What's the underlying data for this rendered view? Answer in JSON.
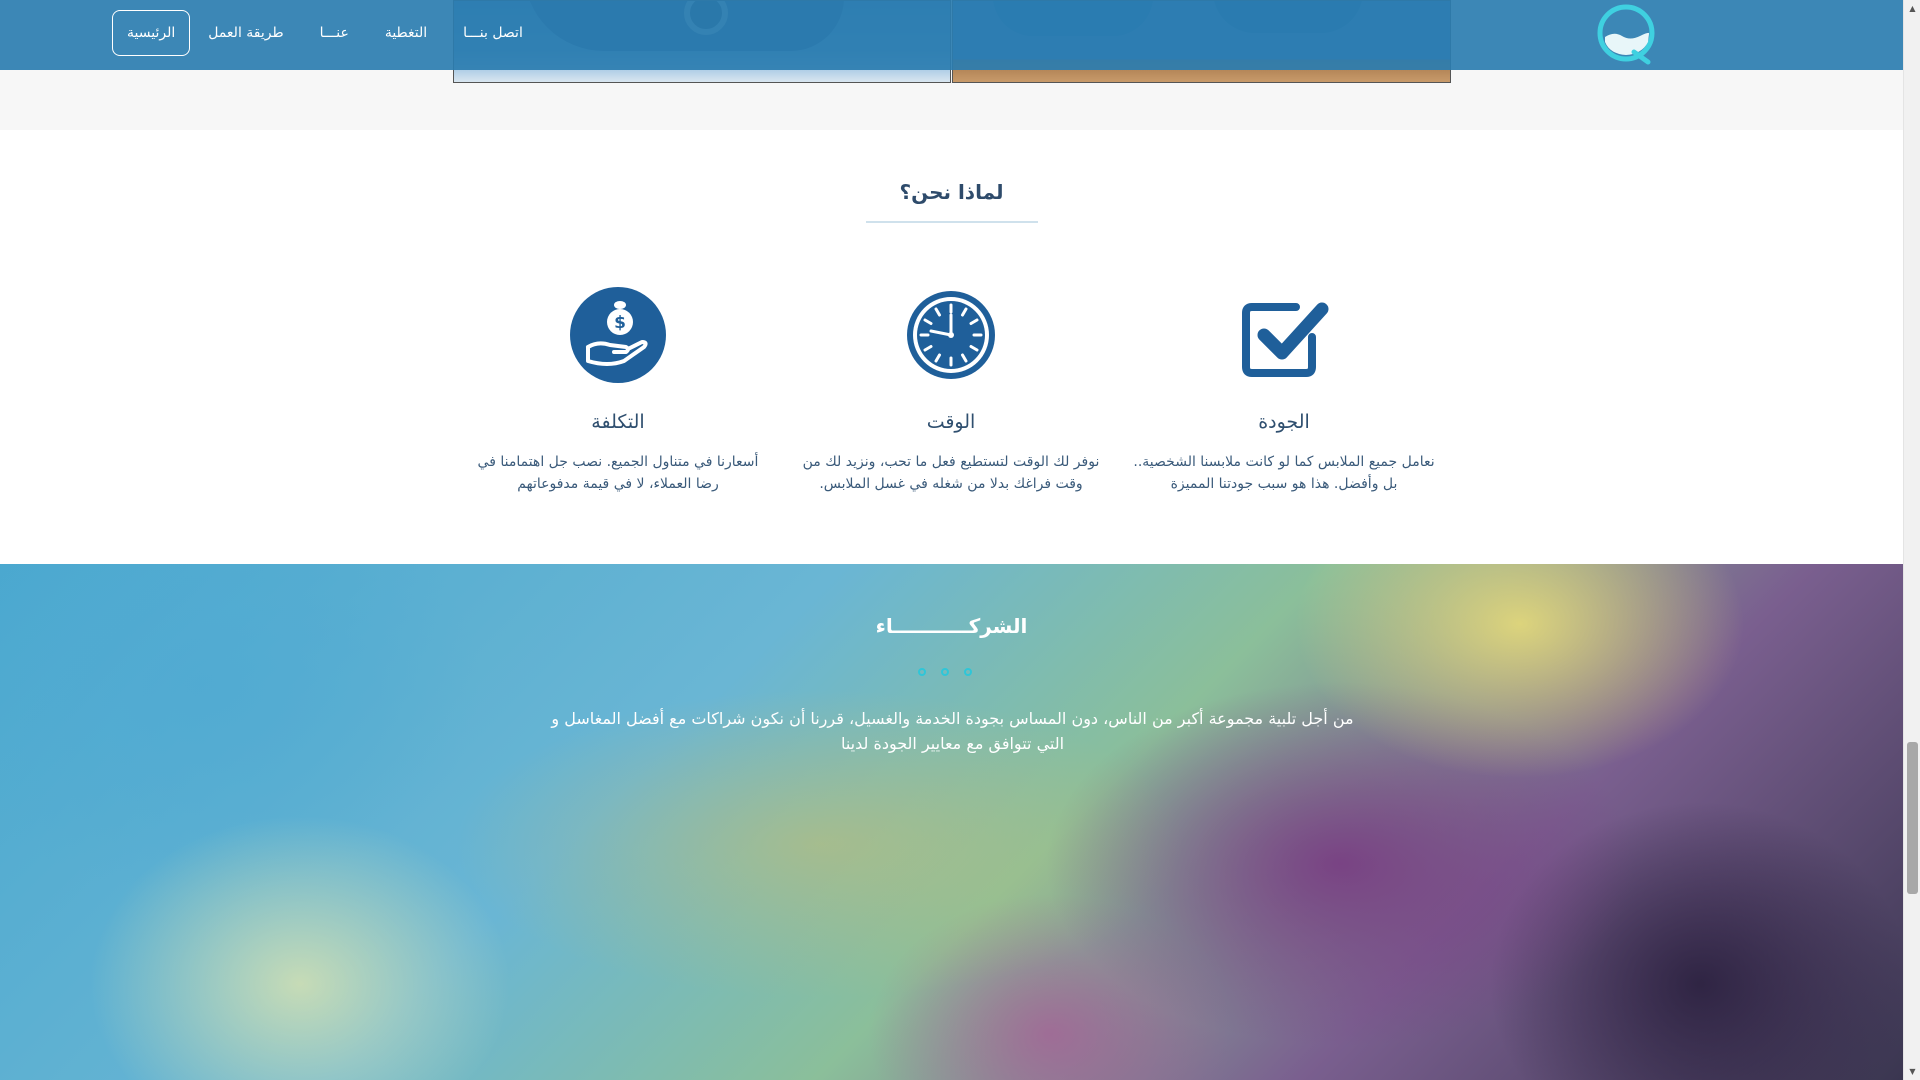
{
  "header": {
    "logo_icon": "water-drop-q-logo-icon",
    "nav": [
      {
        "label": "الرئيسية",
        "active": true
      },
      {
        "label": "طريقة العمل",
        "active": false
      },
      {
        "label": "عنـــا",
        "active": false
      },
      {
        "label": "التغطية",
        "active": false
      },
      {
        "label": "اتصل بنـــا",
        "active": false
      }
    ],
    "background_color": "#2b7db0"
  },
  "why": {
    "title": "لماذا نحن؟",
    "features": {
      "cost": {
        "icon": "hand-coin-icon",
        "title": "التكلفة",
        "text": "أسعارنا في متناول الجميع. نصب جل اهتمامنا في رضا العملاء، لا في قيمة مدفوعاتهم"
      },
      "time": {
        "icon": "clock-icon",
        "title": "الوقت",
        "text": "نوفر لك الوقت لتستطيع فعل ما تحب، ونزيد لك من وقت فراغك بدلا من شغله في غسل الملابس."
      },
      "quality": {
        "icon": "checkmark-box-icon",
        "title": "الجودة",
        "text": "نعامل جميع الملابس كما لو كانت ملابسنا الشخصية.. بل وأفضل. هذا هو سبب جودتنا المميزة"
      }
    },
    "icon_color": "#1f5f9a"
  },
  "partners": {
    "title": "الشركـــــــــــاء",
    "text": "من أجل تلبية مجموعة أكبر من الناس، دون المساس بجودة الخدمة والغسيل، قررنا أن نكون شراكات مع أفضل المغاسل و التي تتوافق مع معايير الجودة لدينا",
    "dot_color": "#2fc6d8"
  }
}
